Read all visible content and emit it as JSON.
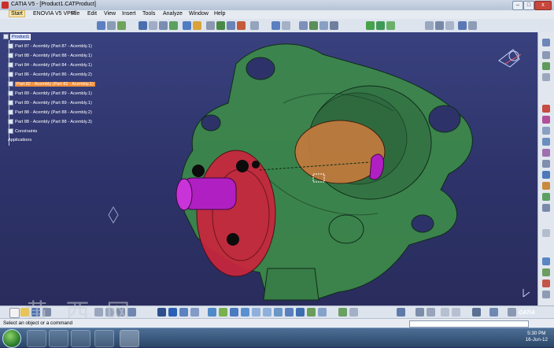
{
  "window": {
    "title": "CATIA V5 - [Product1.CATProduct]",
    "minimize": "–",
    "maximize": "□",
    "close": "x"
  },
  "menu": [
    "Start",
    "ENOVIA V5 VPM",
    "File",
    "Edit",
    "View",
    "Insert",
    "Tools",
    "Analyze",
    "Window",
    "Help"
  ],
  "tree": {
    "root": "Product1",
    "items": [
      {
        "label": "Part 87 - Acembly (Part 87 - Acembly.1)"
      },
      {
        "label": "Part 88 - Acembly (Part 88 - Acembly.1)"
      },
      {
        "label": "Part 84 - Acembly (Part 84 - Acembly.1)"
      },
      {
        "label": "Part 86 - Acembly (Part 86 - Acembly.2)"
      },
      {
        "label": "Part 82 - Acembly (Part 82 - Acembly.1)",
        "selected": true
      },
      {
        "label": "Part 89 - Acembly (Part 89 - Acembly.1)"
      },
      {
        "label": "Part 89 - Acembly (Part 89 - Acembly.1)"
      },
      {
        "label": "Part 88 - Acembly (Part 88 - Acembly.2)"
      },
      {
        "label": "Part 88 - Acembly (Part 88 - Acembly.3)"
      }
    ],
    "constraints": "Constraints",
    "applications": "Applications"
  },
  "status": {
    "prompt": "Select an object or a command"
  },
  "watermark": "黄 西 网",
  "brand": "CATIA",
  "clock": {
    "time": "5:30 PM",
    "date": "16-Jun-12"
  },
  "colors": {
    "housing": "#3d8a4a",
    "flange": "#c9263d",
    "shaft": "#b01fc1",
    "bore": "#c07a3e",
    "selection": "#f08c37",
    "background": "#2d3369"
  }
}
